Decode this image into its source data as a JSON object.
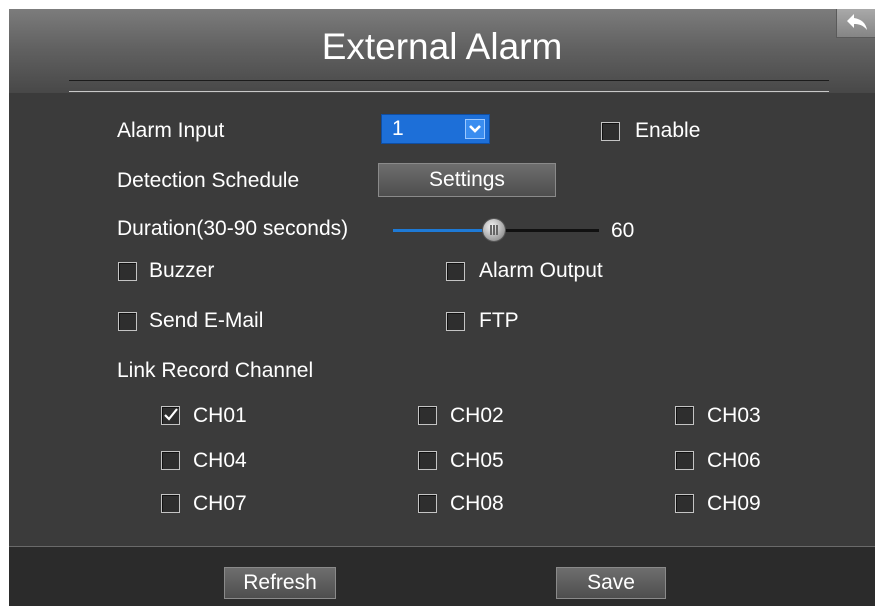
{
  "header": {
    "title": "External Alarm"
  },
  "alarm_input": {
    "label": "Alarm Input",
    "selected": "1",
    "enable_label": "Enable",
    "enable_checked": false
  },
  "detection_schedule": {
    "label": "Detection Schedule",
    "button": "Settings"
  },
  "duration": {
    "label": "Duration(30-90 seconds)",
    "value": "60",
    "min": 30,
    "max": 90
  },
  "options": {
    "buzzer": {
      "label": "Buzzer",
      "checked": false
    },
    "alarm_output": {
      "label": "Alarm Output",
      "checked": false
    },
    "send_email": {
      "label": "Send E-Mail",
      "checked": false
    },
    "ftp": {
      "label": "FTP",
      "checked": false
    }
  },
  "link_record": {
    "label": "Link Record Channel",
    "channels": [
      {
        "label": "CH01",
        "checked": true
      },
      {
        "label": "CH02",
        "checked": false
      },
      {
        "label": "CH03",
        "checked": false
      },
      {
        "label": "CH04",
        "checked": false
      },
      {
        "label": "CH05",
        "checked": false
      },
      {
        "label": "CH06",
        "checked": false
      },
      {
        "label": "CH07",
        "checked": false
      },
      {
        "label": "CH08",
        "checked": false
      },
      {
        "label": "CH09",
        "checked": false
      }
    ]
  },
  "footer": {
    "refresh": "Refresh",
    "save": "Save"
  },
  "colors": {
    "accent": "#1e7ad6",
    "background": "#3b3b3b",
    "text": "#ffffff"
  },
  "icons": {
    "back": "back-arrow-icon",
    "dropdown": "chevron-down-icon",
    "check": "checkmark-icon"
  }
}
